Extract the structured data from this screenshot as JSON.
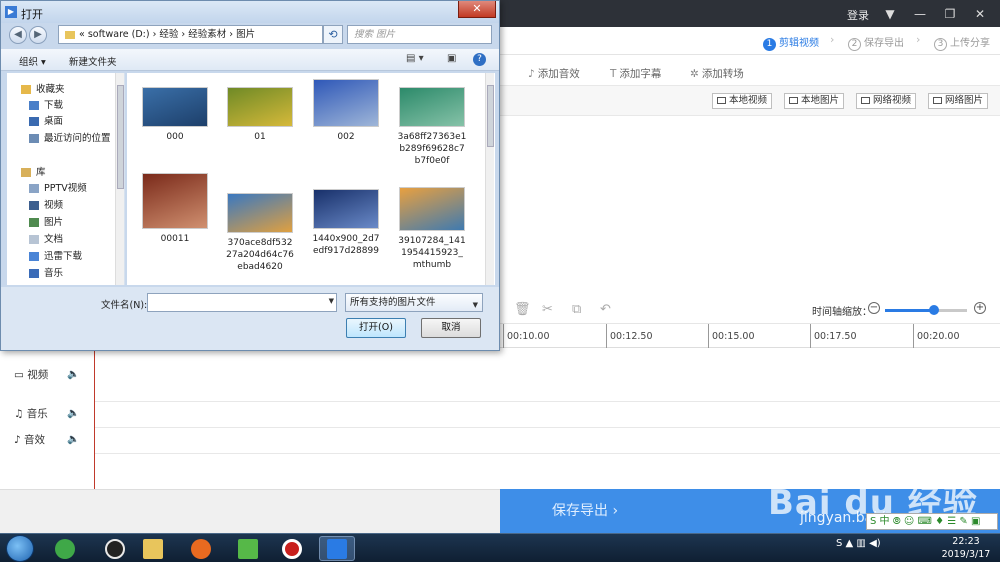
{
  "app": {
    "login": "登录",
    "steps": [
      {
        "num": "1",
        "label": "剪辑视频"
      },
      {
        "num": "2",
        "label": "保存导出"
      },
      {
        "num": "3",
        "label": "上传分享"
      }
    ],
    "tools": [
      "添加音效",
      "添加字幕",
      "添加转场"
    ],
    "media_buttons": [
      "本地视频",
      "本地图片",
      "网络视频",
      "网络图片"
    ],
    "zoom_label": "时间轴缩放：",
    "zoom_level": 0.6,
    "ruler": [
      "00:10.00",
      "00:12.50",
      "00:15.00",
      "00:17.50",
      "00:20.00"
    ],
    "tracks": [
      "视频",
      "音乐",
      "音效"
    ],
    "save_export": "保存导出 ›"
  },
  "dialog": {
    "title": "打开",
    "close": "✕",
    "address": "«  software (D:)  ›  经验  ›  经验素材  ›  图片",
    "search_placeholder": "搜索 图片",
    "organize": "组织 ▾",
    "new_folder": "新建文件夹",
    "nav": {
      "favorites_title": "收藏夹",
      "favorites": [
        "下载",
        "桌面",
        "最近访问的位置"
      ],
      "library_title": "库",
      "library": [
        "PPTV视频",
        "视频",
        "图片",
        "文档",
        "迅雷下载",
        "音乐"
      ]
    },
    "files": [
      {
        "name": "000",
        "colors": [
          "#3a6fa8",
          "#1d3f6a"
        ]
      },
      {
        "name": "01",
        "colors": [
          "#6f8a26",
          "#d6b93a"
        ]
      },
      {
        "name": "002",
        "colors": [
          "#2f58b8",
          "#9fb6d8"
        ]
      },
      {
        "name": "3a68ff27363e1b289f69628c7b7f0e0f",
        "colors": [
          "#2c8a6a",
          "#86c2a8"
        ]
      },
      {
        "name": "00011",
        "colors": [
          "#7a2a1a",
          "#d09070"
        ]
      },
      {
        "name": "370ace8df53227a204d64c76ebad4620",
        "colors": [
          "#3a78c0",
          "#e0a040"
        ]
      },
      {
        "name": "1440x900_2d7edf917d28899",
        "colors": [
          "#18306a",
          "#6a8ac8"
        ]
      },
      {
        "name": "39107284_1411954415923_mthumb",
        "colors": [
          "#e8a040",
          "#3f7ab0"
        ]
      }
    ],
    "filename_label": "文件名(N):",
    "filename_value": "",
    "filetype": "所有支持的图片文件",
    "open_btn": "打开(O)",
    "cancel_btn": "取消"
  },
  "taskbar": {
    "time": "22:23",
    "date": "2019/3/17"
  },
  "watermark": {
    "brand": "Bai du 经验",
    "url": "jingyan.baidu.com"
  },
  "ime": "S 中 ⦾ ☺ ⌨ ♦ ☰ ✎ ▣"
}
